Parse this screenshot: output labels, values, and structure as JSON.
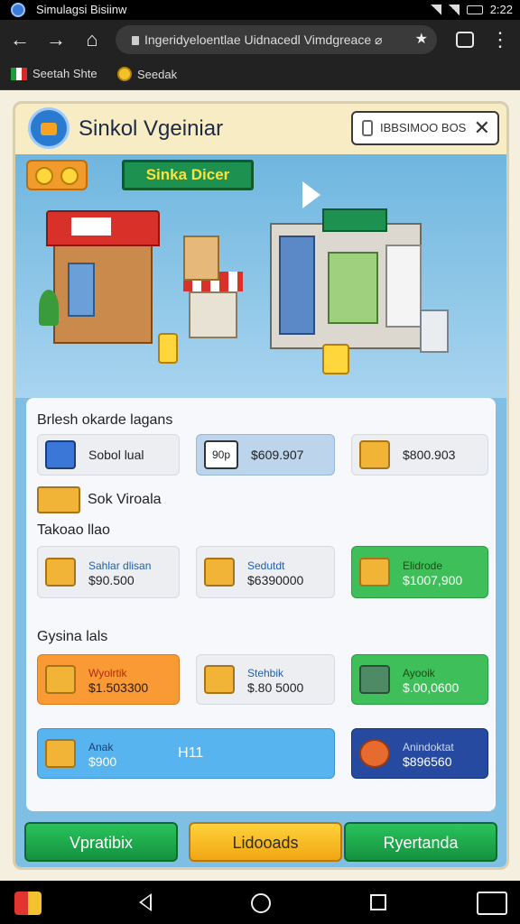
{
  "status_bar": {
    "title": "Simulagsi Bisiinw",
    "time": "2:22"
  },
  "browser": {
    "url": "Ingeridyeloentlae Uidnacedl Vimdgreace ⌀",
    "tab_count": ""
  },
  "bookmarks": [
    {
      "label": "Seetah Shte"
    },
    {
      "label": "Seedak"
    }
  ],
  "game": {
    "title": "Sinkol Vgeiniar",
    "search_text": "IBBSIMOO BOS",
    "hero_sign": "Sinka Dicer",
    "sections": [
      {
        "label": "Brlesh okarde lagans"
      },
      {
        "label": "Sok Viroala"
      },
      {
        "label": "Takoao llao"
      },
      {
        "label": "Gysina lals"
      }
    ],
    "row1": [
      {
        "name": "Sobol lual",
        "price": "",
        "icon": "book-icon"
      },
      {
        "name": "",
        "price": "$609.907",
        "tag": "90p",
        "icon": "price-tag-icon"
      },
      {
        "name": "",
        "price": "$800.903",
        "icon": "box-icon"
      }
    ],
    "row2": [
      {
        "name": "Sahlar dlisan",
        "price": "$90.500",
        "icon": "crate-icon"
      },
      {
        "name": "Sedutdt",
        "price": "$6390000",
        "icon": "parcel-icon"
      },
      {
        "name": "Elidrode",
        "price": "$1007,900",
        "icon": "box-icon"
      }
    ],
    "row3": [
      {
        "name": "Wyolrtik",
        "price": "$1.503300",
        "icon": "box-icon"
      },
      {
        "name": "Stehbik",
        "price": "$.80 5000",
        "icon": "basket-icon"
      },
      {
        "name": "Ayooik",
        "price": "$.00,0600",
        "icon": "basket-icon"
      }
    ],
    "row4": [
      {
        "name": "Anak",
        "price": "$900",
        "extra": "H11",
        "icon": "box-icon"
      },
      {
        "name": "Anindoktat",
        "price": "$896560",
        "icon": "bowl-icon"
      }
    ],
    "buttons": {
      "left": "Vpratibix",
      "middle": "Lidooads",
      "right": "Ryertanda"
    }
  }
}
